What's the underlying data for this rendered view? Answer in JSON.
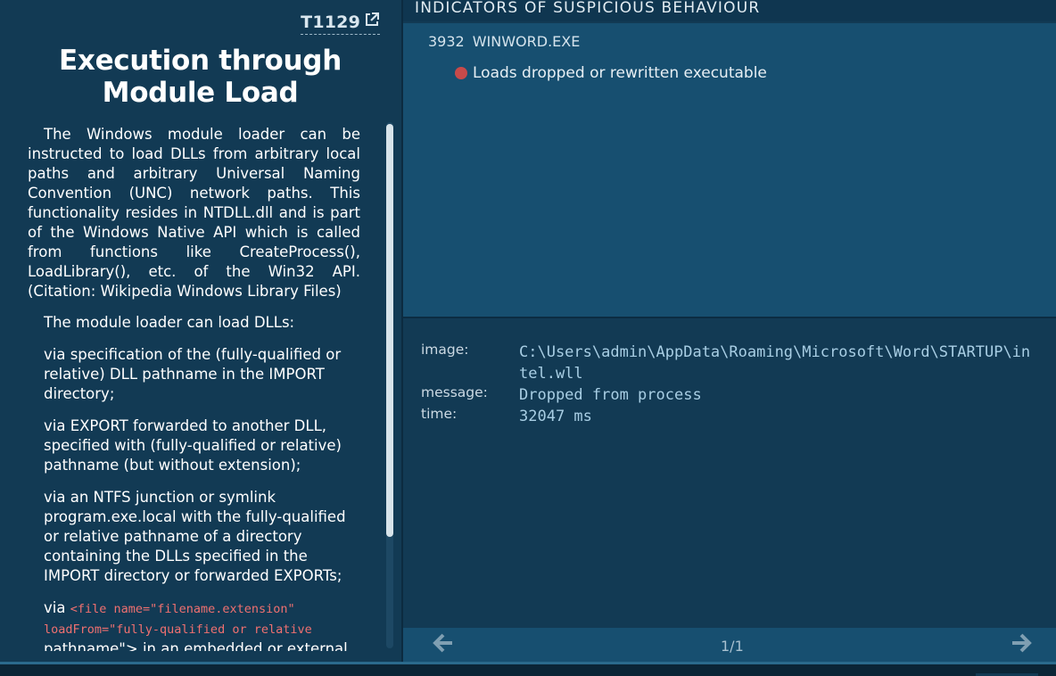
{
  "technique": {
    "id": "T1129",
    "title": "Execution through Module Load",
    "link_icon": "external-link-icon",
    "description": {
      "para1": "The Windows module loader can be instructed to load DLLs from arbitrary local paths and arbitrary Universal Naming Convention (UNC) network paths. This functionality resides in NTDLL.dll and is part of the Windows Native API which is called from functions like CreateProcess(), LoadLibrary(), etc. of the Win32 API. (Citation: Wikipedia Windows Library Files)",
      "para2": "The module loader can load DLLs:",
      "para3": "via specification of the (fully-qualified or relative) DLL pathname in the IMPORT directory;",
      "para4": "via EXPORT forwarded to another DLL, specified with (fully-qualified or relative) pathname (but without extension);",
      "para5": "via an NTFS junction or symlink program.exe.local with the fully-qualified or relative pathname of a directory containing the DLLs specified in the IMPORT directory or forwarded EXPORTs;",
      "para6_prefix": "via",
      "para6_code": "<file name=\"filename.extension\" loadFrom=\"fully-qualified or relative",
      "para6_rest": "pathname\"> in an embedded or external"
    }
  },
  "indicators": {
    "header": "INDICATORS OF SUSPICIOUS BEHAVIOUR",
    "process_pid": "3932",
    "process_name": "WINWORD.EXE",
    "items": [
      {
        "label": "Loads dropped or rewritten executable",
        "severity_color": "#c84a4a"
      }
    ]
  },
  "details": {
    "image_label": "image:",
    "image_value": "C:\\Users\\admin\\AppData\\Roaming\\Microsoft\\Word\\STARTUP\\intel.wll",
    "message_label": "message:",
    "message_value": "Dropped from process",
    "time_label": "time:",
    "time_value": "32047 ms"
  },
  "pagination": {
    "text": "1/1",
    "prev_icon": "arrow-left-icon",
    "next_icon": "arrow-right-icon"
  },
  "colors": {
    "panel_dark": "#123a54",
    "panel_light": "#174f70",
    "alert_red": "#c84a4a",
    "code_red": "#ef7070",
    "mono_value": "#a8cee4"
  }
}
